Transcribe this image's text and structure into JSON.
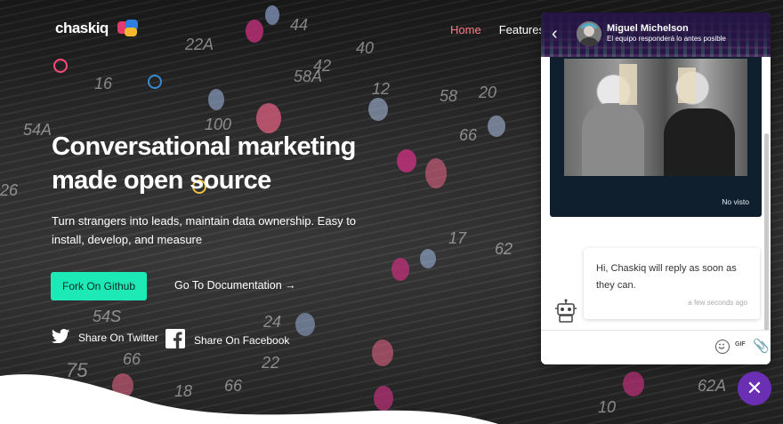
{
  "brand": {
    "name": "chaskiq"
  },
  "nav": {
    "items": [
      "Home",
      "Features"
    ]
  },
  "hero": {
    "headline": "Conversational marketing made open source",
    "subtext": "Turn strangers into leads, maintain data ownership. Easy to install, develop, and measure",
    "cta_primary": "Fork On Github",
    "cta_secondary": "Go To Documentation →",
    "share_twitter": "Share On Twitter",
    "share_facebook": "Share On Facebook"
  },
  "chat": {
    "agent_name": "Miguel Michelson",
    "agent_status": "El equipo responderá lo antes posible",
    "image_status": "No visto",
    "message_text": "Hi, Chaskiq will reply as soon as they can.",
    "message_time": "a few seconds ago",
    "gif_label": "GIF"
  },
  "colors": {
    "accent": "#1de9b6",
    "nav_active": "#ff7a8a",
    "launcher": "#6b2fb3",
    "header": "#241444"
  }
}
